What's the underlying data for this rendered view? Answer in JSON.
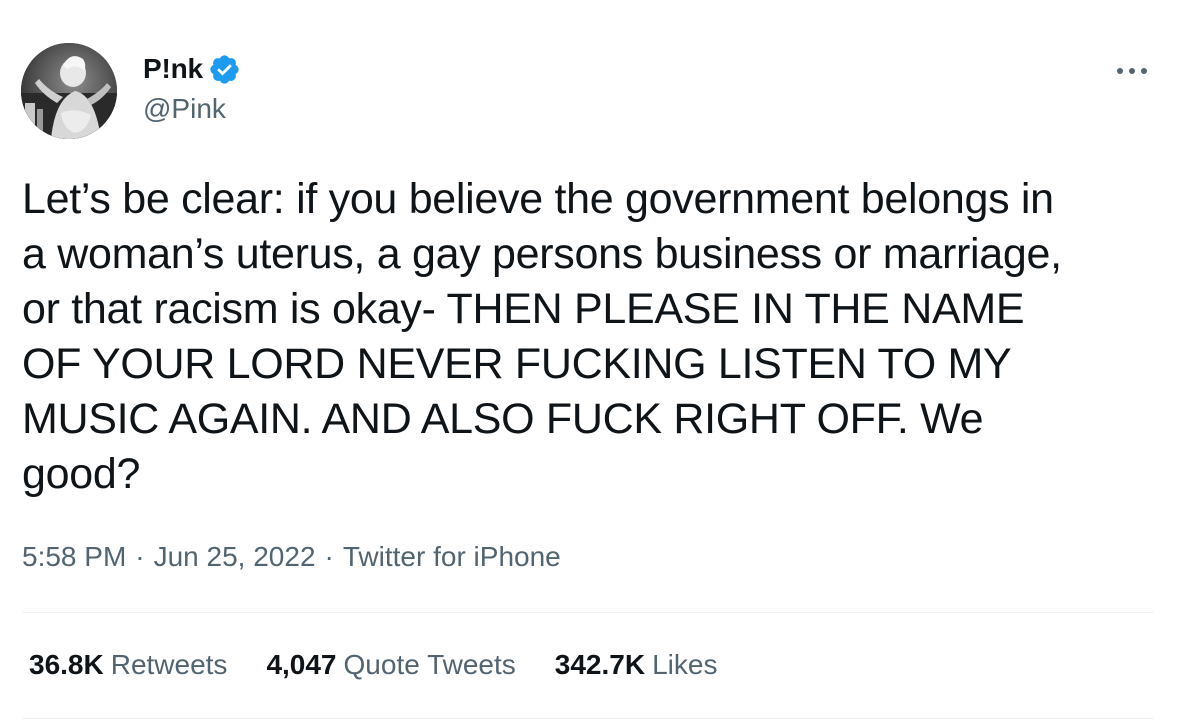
{
  "author": {
    "display_name": "P!nk",
    "handle": "@Pink",
    "verified": true
  },
  "tweet": {
    "line_1": "Let’s be clear: if you believe the government belongs in",
    "line_2": "a woman’s uterus, a gay persons business or marriage,",
    "line_3": "or that racism is okay- THEN PLEASE IN THE NAME",
    "line_4": "OF YOUR LORD NEVER FUCKING LISTEN TO MY",
    "line_5": "MUSIC AGAIN. AND ALSO FUCK RIGHT OFF. We",
    "line_6": "good?"
  },
  "meta": {
    "time": "5:58 PM",
    "separator": "·",
    "date": "Jun 25, 2022",
    "source": "Twitter for iPhone"
  },
  "stats": {
    "retweets_count": "36.8K",
    "retweets_label": "Retweets",
    "quotes_count": "4,047",
    "quotes_label": "Quote Tweets",
    "likes_count": "342.7K",
    "likes_label": "Likes"
  },
  "icons": {
    "verified": "verified-badge-icon",
    "more": "more-options-icon"
  },
  "colors": {
    "verified_blue": "#1d9bf0",
    "text_primary": "#0f1419",
    "text_secondary": "#536471",
    "divider": "#eff3f4"
  }
}
